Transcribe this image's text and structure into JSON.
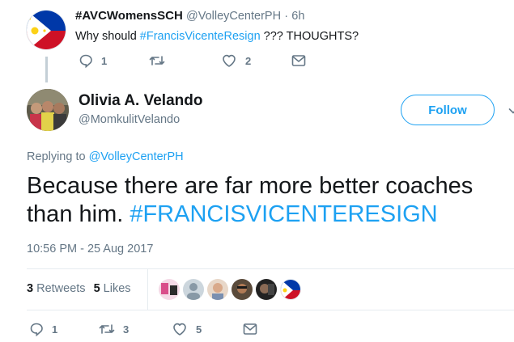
{
  "parent_tweet": {
    "display_name": "#AVCWomensSCH",
    "handle": "@VolleyCenterPH",
    "separator": "·",
    "time": "6h",
    "text_before": "Why should ",
    "hashtag": "#FrancisVicenteResign",
    "text_after": " ??? THOUGHTS?",
    "replies": "1",
    "retweets": "",
    "likes": "2"
  },
  "main_tweet": {
    "display_name": "Olivia A. Velando",
    "handle": "@MomkulitVelando",
    "follow_label": "Follow",
    "replying_prefix": "Replying to ",
    "replying_to": "@VolleyCenterPH",
    "text": "Because there are far more better coaches than him. ",
    "hashtag": "#FRANCISVICENTERESIGN",
    "timestamp": "10:56 PM - 25 Aug 2017",
    "retweet_count": "3",
    "retweet_label": "Retweets",
    "like_count": "5",
    "like_label": "Likes",
    "replies": "1",
    "retweets": "3",
    "likes": "5"
  },
  "icons": {
    "reply": "reply-icon",
    "retweet": "retweet-icon",
    "like": "heart-icon",
    "message": "envelope-icon",
    "more": "chevron-down-icon"
  },
  "colors": {
    "accent": "#1da1f2",
    "text": "#14171a",
    "secondary": "#657786",
    "divider": "#e6ecf0"
  }
}
